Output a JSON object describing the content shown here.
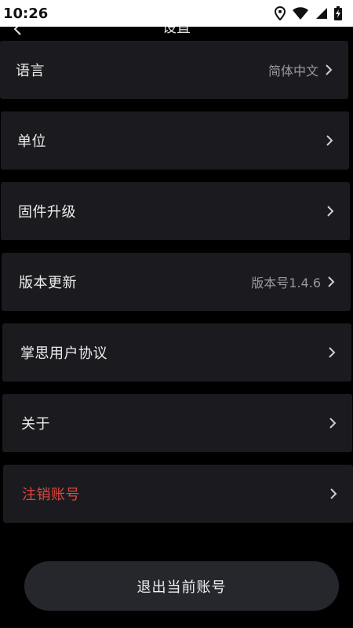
{
  "status_bar": {
    "time": "10:26"
  },
  "nav": {
    "title": "设置",
    "back_icon": "back-arrow-icon"
  },
  "settings": {
    "items": [
      {
        "label": "语言",
        "value": "简体中文"
      },
      {
        "label": "单位",
        "value": ""
      },
      {
        "label": "固件升级",
        "value": ""
      },
      {
        "label": "版本更新",
        "value": "版本号1.4.6"
      },
      {
        "label": "掌思用户协议",
        "value": ""
      },
      {
        "label": "关于",
        "value": ""
      },
      {
        "label": "注销账号",
        "value": ""
      }
    ]
  },
  "logout": {
    "label": "退出当前账号"
  },
  "colors": {
    "background": "#000000",
    "row_background": "#1b1b1f",
    "danger": "#e0463f",
    "button_background": "#26272d"
  }
}
